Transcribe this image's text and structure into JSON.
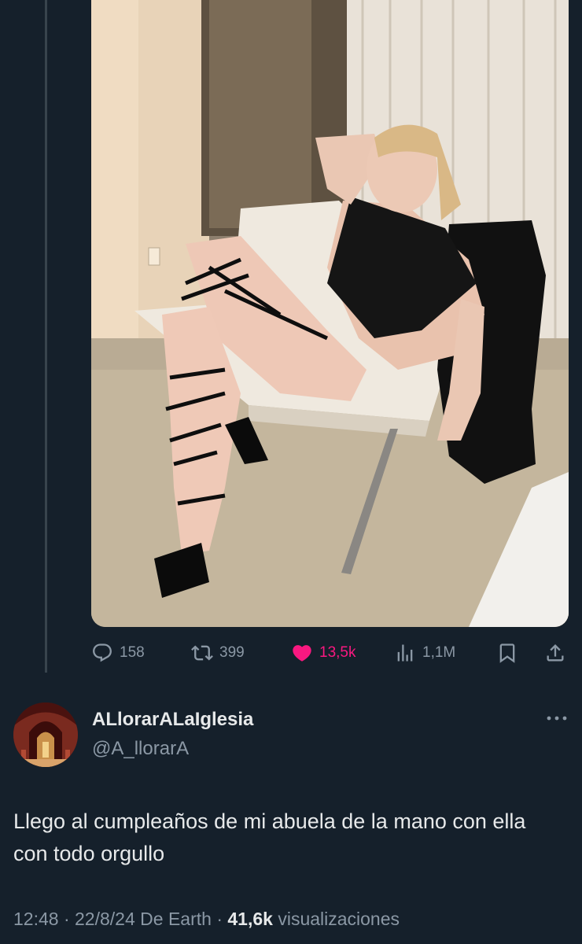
{
  "thread": {
    "actions": {
      "replies": "158",
      "retweets": "399",
      "likes": "13,5k",
      "views": "1,1M"
    },
    "icons": [
      "reply-icon",
      "retweet-icon",
      "heart-filled-icon",
      "views-icon",
      "bookmark-icon",
      "share-icon"
    ]
  },
  "reply": {
    "display_name": "ALlorarALaIglesia",
    "handle": "@A_llorarA",
    "text": "Llego al cumpleaños de mi abuela de la mano con ella con todo orgullo",
    "time": "12:48",
    "date": "22/8/24",
    "source": "De Earth",
    "views_count": "41,6k",
    "views_label": "visualizaciones",
    "separator": "·"
  },
  "colors": {
    "background": "#15202b",
    "muted": "#8b98a5",
    "text": "#e7e9ea",
    "like": "#f91880",
    "thread_line": "#38444d"
  }
}
